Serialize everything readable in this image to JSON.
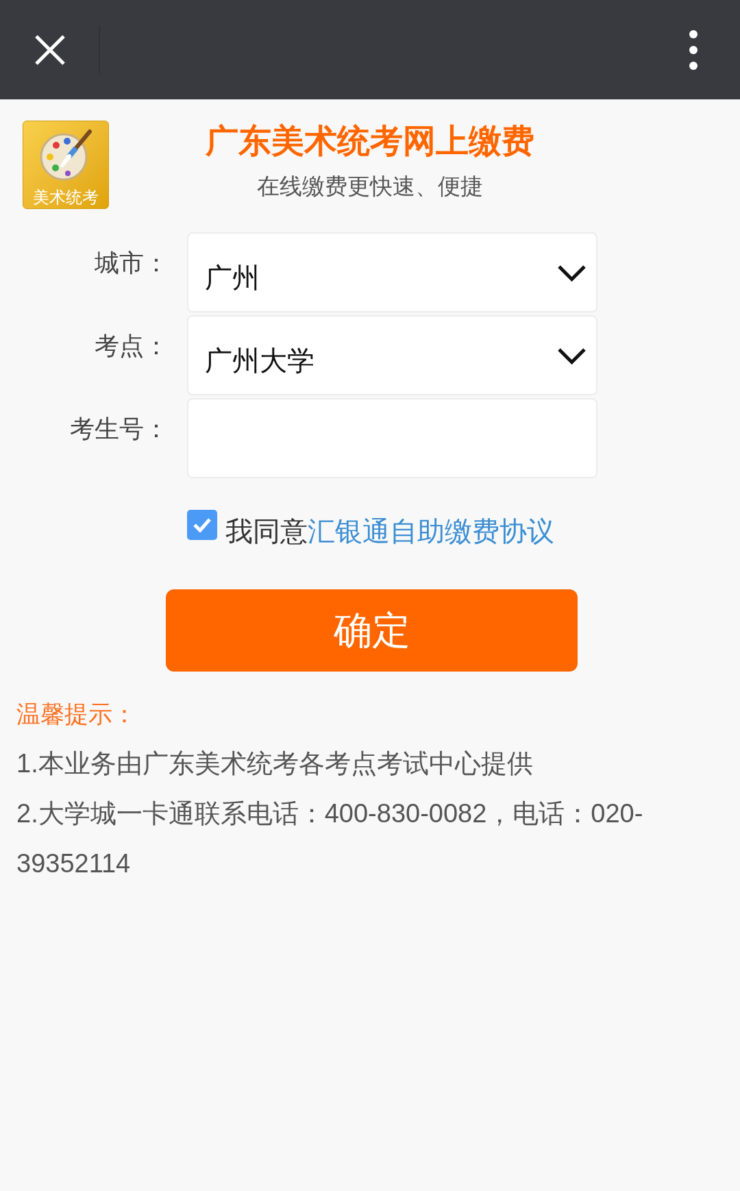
{
  "header": {
    "logo_text": "美术统考",
    "title": "广东美术统考网上缴费",
    "subtitle": "在线缴费更快速、便捷"
  },
  "form": {
    "fields": [
      {
        "kind": "select",
        "label": "城市：",
        "value": "广州"
      },
      {
        "kind": "select",
        "label": "考点：",
        "value": "广州大学"
      },
      {
        "kind": "input",
        "label": "考生号："
      }
    ]
  },
  "agreement": {
    "checked": true,
    "text": "我同意",
    "link": "汇银通自助缴费协议"
  },
  "submit_button": "确定",
  "tips": {
    "heading": "温馨提示：",
    "items": [
      "1.本业务由广东美术统考各考点考试中心提供",
      "2.大学城一卡通联系电话：400-830-0082，电话：020-39352114"
    ]
  }
}
